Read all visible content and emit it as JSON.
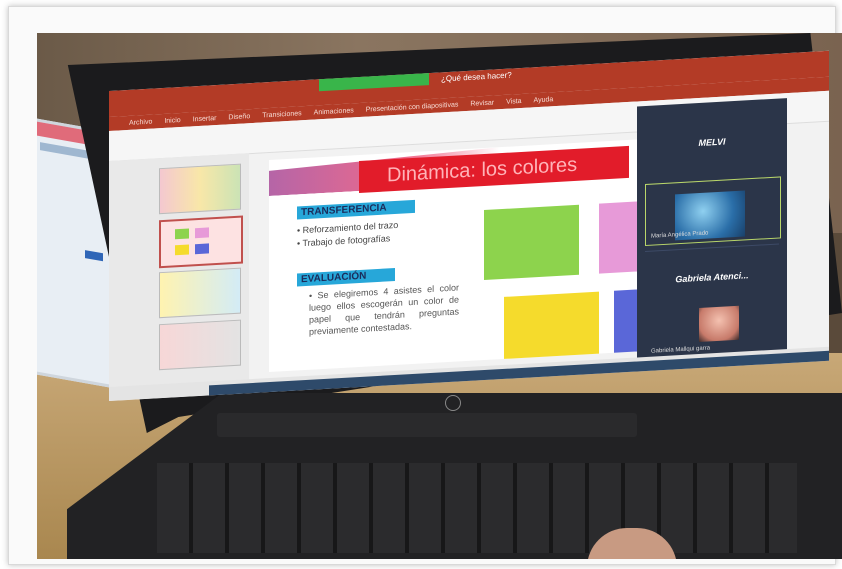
{
  "title_bar": {
    "text": "¿Qué desea hacer?"
  },
  "ribbon_tabs": [
    "Archivo",
    "Inicio",
    "Insertar",
    "Diseño",
    "Transiciones",
    "Animaciones",
    "Presentación con diapositivas",
    "Revisar",
    "Vista",
    "Ayuda"
  ],
  "slide": {
    "title": "Dinámica: los colores",
    "section1": {
      "heading": "TRANSFERENCIA",
      "bullets": [
        "Reforzamiento del trazo",
        "Trabajo de fotografías"
      ]
    },
    "section2": {
      "heading": "EVALUACIÓN",
      "text": "Se elegiremos 4 asistes el color luego ellos escogerán un color de papel que tendrán preguntas previamente contestadas."
    },
    "colors": {
      "green": "#8dd34d",
      "pink": "#e79ad8",
      "yellow": "#f5db2c",
      "blue": "#5a67d8",
      "title_bg": "#e21c2a",
      "section_bg": "#27a7d9"
    }
  },
  "zoom_panel": {
    "top_name": "MELVI",
    "tile1_caption": "María Angélica Prado",
    "tile2_name": "Gabriela Atenci...",
    "tile2_caption": "Gabriela Mallqui garra"
  }
}
